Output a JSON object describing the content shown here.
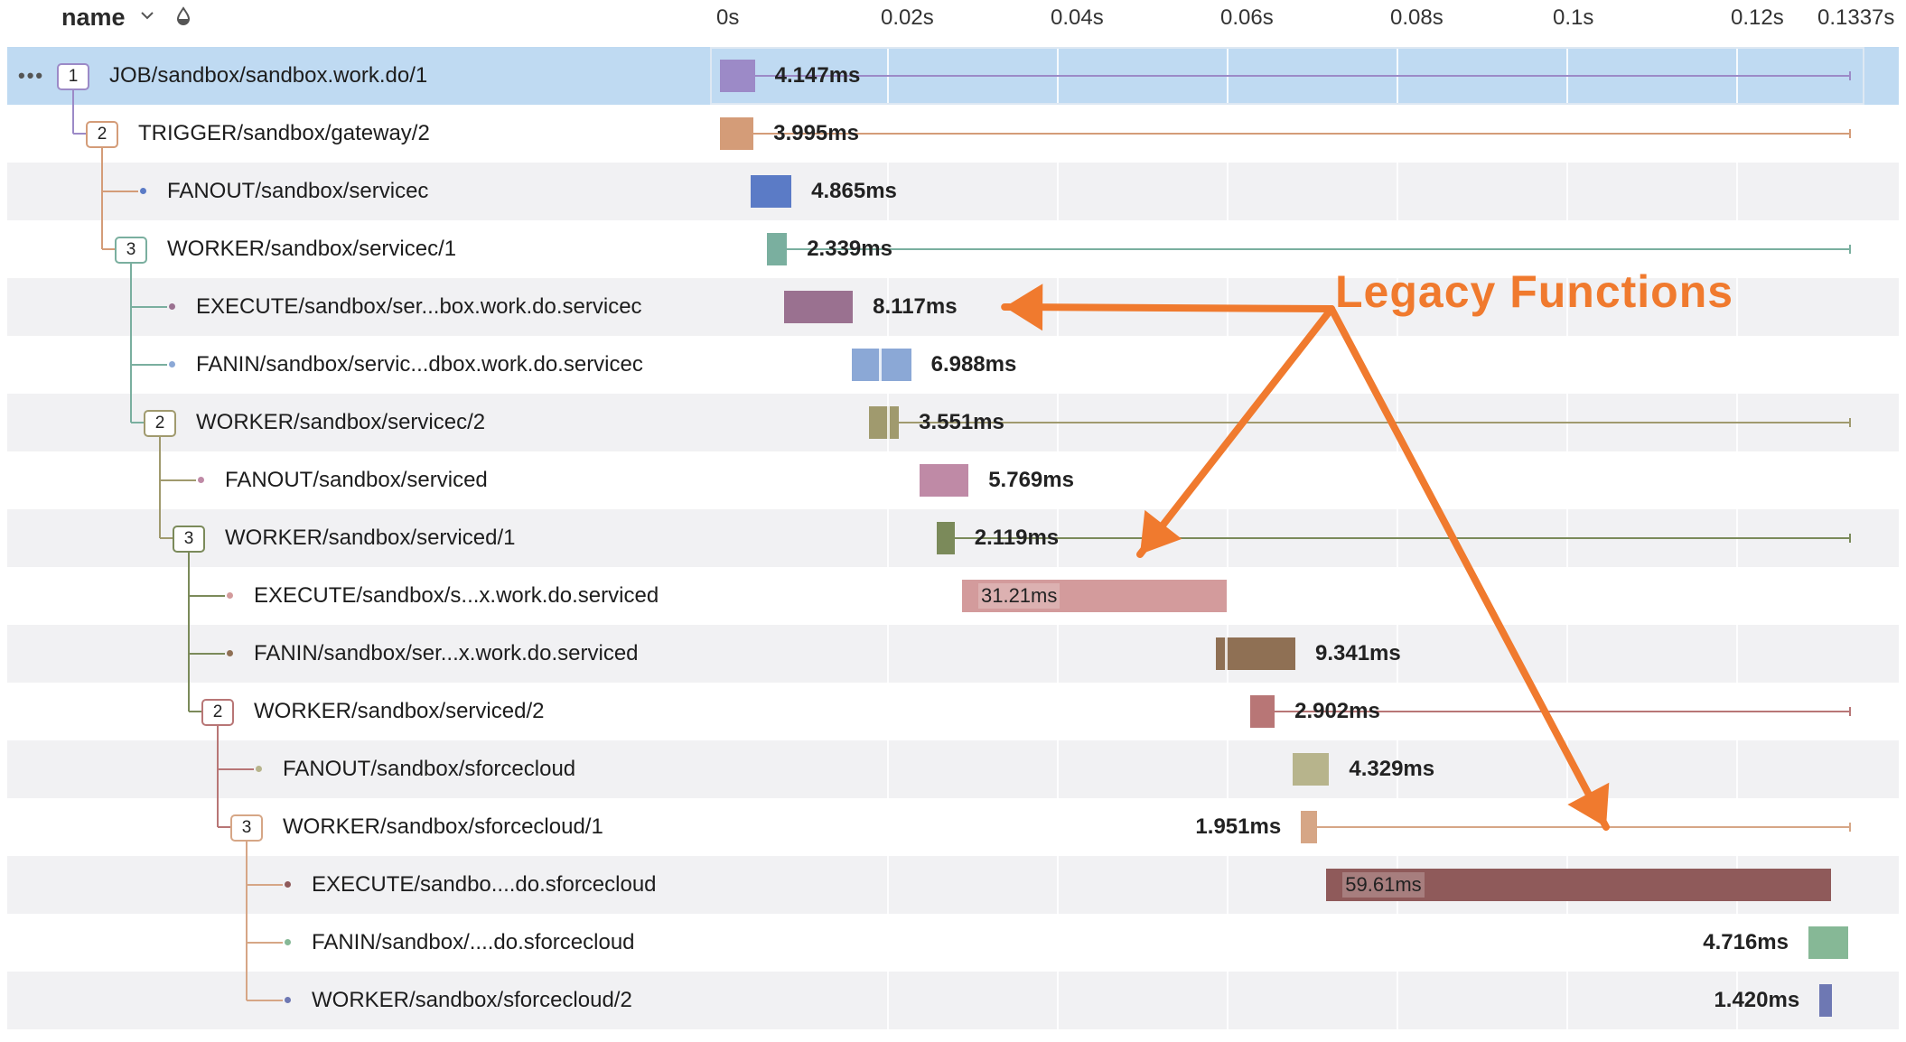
{
  "header": {
    "name_label": "name",
    "name_sort_icon": "chevron-down-icon",
    "filter_icon": "droplet-icon",
    "ticks": [
      "0s",
      "0.02s",
      "0.04s",
      "0.06s",
      "0.08s",
      "0.1s",
      "0.12s",
      "0.1337s"
    ]
  },
  "timeline": {
    "range_seconds": [
      0,
      0.1337
    ]
  },
  "rows": [
    {
      "id": "r0",
      "label": "JOB/sandbox/sandbox.work.do/1",
      "depth": 0,
      "node": "badge",
      "badge": "1",
      "color": "#9c8ac7",
      "start_ms": 0.4,
      "dur_ms": 4.147,
      "duration_text": "4.147ms",
      "rule_end_ms": 133.7,
      "selected": true
    },
    {
      "id": "r1",
      "label": "TRIGGER/sandbox/gateway/2",
      "depth": 1,
      "node": "badge",
      "badge": "2",
      "color": "#d49c78",
      "start_ms": 0.4,
      "dur_ms": 3.995,
      "duration_text": "3.995ms",
      "rule_end_ms": 133.7
    },
    {
      "id": "r2",
      "label": "FANOUT/sandbox/servicec",
      "depth": 2,
      "node": "dot",
      "color": "#5b7bc6",
      "start_ms": 4.0,
      "dur_ms": 4.865,
      "duration_text": "4.865ms"
    },
    {
      "id": "r3",
      "label": "WORKER/sandbox/servicec/1",
      "depth": 2,
      "node": "badge",
      "badge": "3",
      "color": "#7aaf9f",
      "start_ms": 6.0,
      "dur_ms": 2.339,
      "duration_text": "2.339ms",
      "rule_end_ms": 133.7
    },
    {
      "id": "r4",
      "label": "EXECUTE/sandbox/ser...box.work.do.servicec",
      "depth": 3,
      "node": "dot",
      "color": "#9a7190",
      "start_ms": 8.0,
      "dur_ms": 8.117,
      "duration_text": "8.117ms"
    },
    {
      "id": "r5",
      "label": "FANIN/sandbox/servic...dbox.work.do.servicec",
      "depth": 3,
      "node": "dot",
      "color": "#8ba8d6",
      "start_ms": 16.0,
      "dur_ms": 6.988,
      "duration_text": "6.988ms",
      "split_ms": [
        19.2
      ]
    },
    {
      "id": "r6",
      "label": "WORKER/sandbox/servicec/2",
      "depth": 3,
      "node": "badge",
      "badge": "2",
      "color": "#a09a6e",
      "start_ms": 18.0,
      "dur_ms": 3.551,
      "duration_text": "3.551ms",
      "split_ms": [
        20.2
      ],
      "rule_end_ms": 133.7
    },
    {
      "id": "r7",
      "label": "FANOUT/sandbox/serviced",
      "depth": 4,
      "node": "dot",
      "color": "#bf8aa6",
      "start_ms": 24.0,
      "dur_ms": 5.769,
      "duration_text": "5.769ms"
    },
    {
      "id": "r8",
      "label": "WORKER/sandbox/serviced/1",
      "depth": 4,
      "node": "badge",
      "badge": "3",
      "color": "#7b8a5a",
      "start_ms": 26.0,
      "dur_ms": 2.119,
      "duration_text": "2.119ms",
      "rule_end_ms": 133.7
    },
    {
      "id": "r9",
      "label": "EXECUTE/sandbox/s...x.work.do.serviced",
      "depth": 5,
      "node": "dot",
      "color": "#d39b9c",
      "start_ms": 29.0,
      "dur_ms": 31.21,
      "duration_text": "31.21ms",
      "text_inside": true
    },
    {
      "id": "r10",
      "label": "FANIN/sandbox/ser...x.work.do.serviced",
      "depth": 5,
      "node": "dot",
      "color": "#8f7054",
      "start_ms": 59.0,
      "dur_ms": 9.341,
      "duration_text": "9.341ms",
      "split_ms": [
        60.0
      ]
    },
    {
      "id": "r11",
      "label": "WORKER/sandbox/serviced/2",
      "depth": 5,
      "node": "badge",
      "badge": "2",
      "color": "#b87676",
      "start_ms": 63.0,
      "dur_ms": 2.902,
      "duration_text": "2.902ms",
      "rule_end_ms": 133.7
    },
    {
      "id": "r12",
      "label": "FANOUT/sandbox/sforcecloud",
      "depth": 6,
      "node": "dot",
      "color": "#b7b48c",
      "start_ms": 68.0,
      "dur_ms": 4.329,
      "duration_text": "4.329ms"
    },
    {
      "id": "r13",
      "label": "WORKER/sandbox/sforcecloud/1",
      "depth": 6,
      "node": "badge",
      "badge": "3",
      "color": "#d6a686",
      "start_ms": 69.0,
      "dur_ms": 1.951,
      "duration_text": "1.951ms",
      "text_left": true,
      "rule_end_ms": 133.7
    },
    {
      "id": "r14",
      "label": "EXECUTE/sandbo....do.sforcecloud",
      "depth": 7,
      "node": "dot",
      "color": "#8f5a5a",
      "start_ms": 72.0,
      "dur_ms": 59.61,
      "duration_text": "59.61ms",
      "text_inside": true
    },
    {
      "id": "r15",
      "label": "FANIN/sandbox/....do.sforcecloud",
      "depth": 7,
      "node": "dot",
      "color": "#86b896",
      "start_ms": 128.9,
      "dur_ms": 4.716,
      "duration_text": "4.716ms",
      "text_left": true
    },
    {
      "id": "r16",
      "label": "WORKER/sandbox/sforcecloud/2",
      "depth": 7,
      "node": "dot",
      "color": "#6e78b3",
      "start_ms": 130.2,
      "dur_ms": 1.42,
      "duration_text": "1.420ms",
      "text_left": true
    }
  ],
  "annotation": {
    "text": "Legacy Functions",
    "color": "#f07a2e",
    "targets": [
      "r4",
      "r8",
      "r13"
    ]
  }
}
